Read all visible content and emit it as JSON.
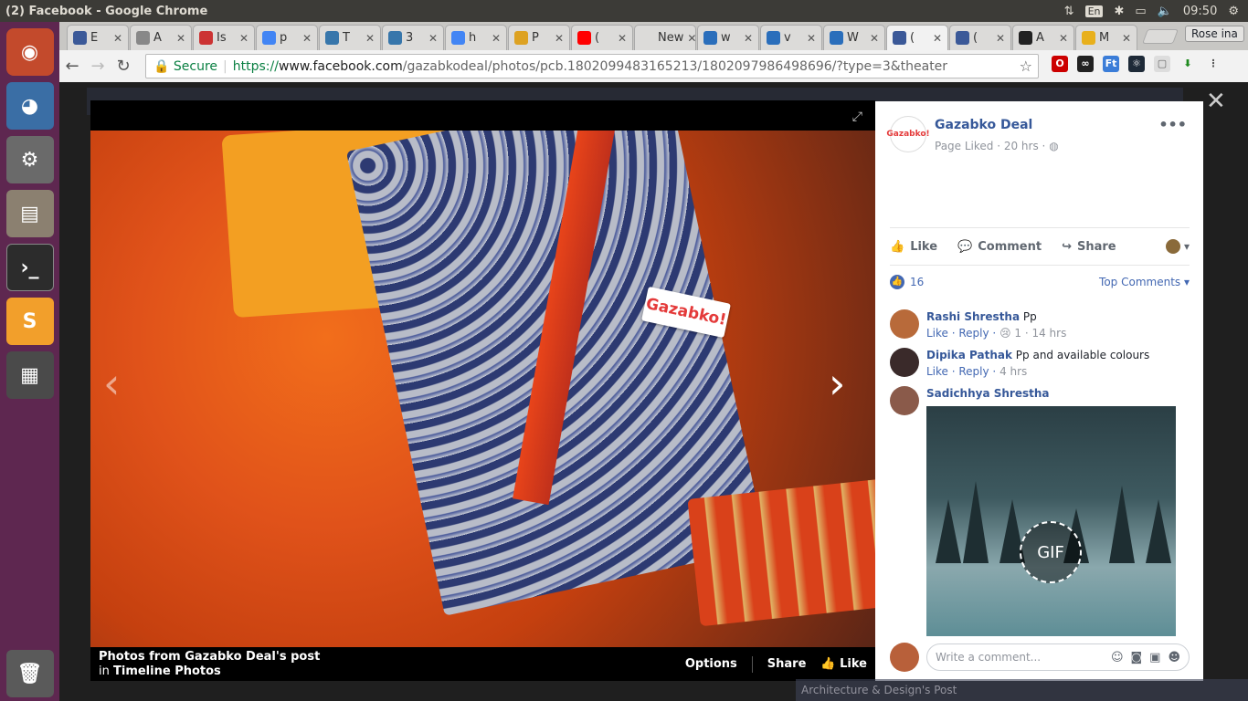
{
  "os": {
    "window_title": "(2) Facebook - Google Chrome",
    "lang": "En",
    "time": "09:50"
  },
  "browser": {
    "tabs": [
      {
        "label": "E",
        "color": "#3b5998"
      },
      {
        "label": "A",
        "color": "#888888"
      },
      {
        "label": "Is",
        "color": "#cc3333"
      },
      {
        "label": "p",
        "color": "#4285f4"
      },
      {
        "label": "T",
        "color": "#3776ab"
      },
      {
        "label": "3",
        "color": "#3776ab"
      },
      {
        "label": "h",
        "color": "#4285f4"
      },
      {
        "label": "P",
        "color": "#dda222"
      },
      {
        "label": "(",
        "color": "#ff0000"
      },
      {
        "label": "New",
        "color": "#dcdbd9"
      },
      {
        "label": "w",
        "color": "#2a6ebb"
      },
      {
        "label": "v",
        "color": "#2a6ebb"
      },
      {
        "label": "W",
        "color": "#2a6ebb"
      },
      {
        "label": "(",
        "color": "#3b5998"
      },
      {
        "label": "(",
        "color": "#3b5998"
      },
      {
        "label": "A",
        "color": "#222222"
      },
      {
        "label": "M",
        "color": "#e8b01c"
      }
    ],
    "user": "Rose ina",
    "secure_label": "Secure",
    "url_scheme": "https://",
    "url_host": "www.facebook.com",
    "url_path": "/gazabkodeal/photos/pcb.1802099483165213/1802097986498696/?type=3&theater"
  },
  "viewer": {
    "tag_text": "Gazabko!",
    "caption_line1": "Photos from Gazabko Deal's post",
    "caption_in": "in",
    "caption_album": "Timeline Photos",
    "options": "Options",
    "share": "Share",
    "like": "Like"
  },
  "post": {
    "page_name": "Gazabko Deal",
    "avatar_text": "Gazabko!",
    "meta": "Page Liked · 20 hrs ·",
    "like": "Like",
    "comment": "Comment",
    "share": "Share",
    "reaction_count": "16",
    "top_comments": "Top Comments ▾"
  },
  "comments": [
    {
      "name": "Rashi Shrestha",
      "text": "Pp",
      "links": "Like · Reply ·",
      "extra": "😢 1 · 14 hrs",
      "avatar_color": "#b86a3a"
    },
    {
      "name": "Dipika Pathak",
      "text": "Pp and available colours",
      "links": "Like · Reply ·",
      "extra": "4 hrs",
      "avatar_color": "#3a2a2a"
    },
    {
      "name": "Sadichhya Shrestha",
      "text": "",
      "links": "",
      "extra": "",
      "avatar_color": "#8a5a4a"
    }
  ],
  "gif_label": "GIF",
  "write_comment_placeholder": "Write a comment...",
  "bg_strip": "Architecture & Design's Post"
}
